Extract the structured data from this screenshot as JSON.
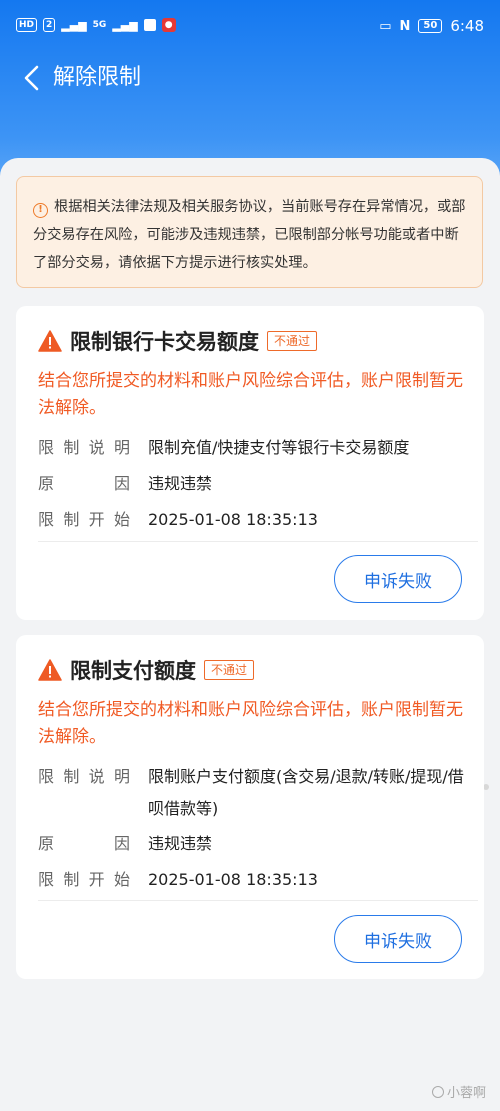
{
  "status_bar": {
    "chips": [
      "HD",
      "2",
      "5G"
    ],
    "time": "6:48",
    "battery": "50"
  },
  "header": {
    "title": "解除限制"
  },
  "notice": {
    "text": "根据相关法律法规及相关服务协议，当前账号存在异常情况，或部分交易存在风险，可能涉及违规违禁，已限制部分帐号功能或者中断了部分交易，请依据下方提示进行核实处理。"
  },
  "cards": [
    {
      "title": "限制银行卡交易额度",
      "badge": "不通过",
      "warning": "结合您所提交的材料和账户风险综合评估，账户限制暂无法解除。",
      "rows": [
        {
          "label": [
            "限",
            "制",
            "说",
            "明"
          ],
          "value": "限制充值/快捷支付等银行卡交易额度"
        },
        {
          "label": [
            "原",
            "因"
          ],
          "value": "违规违禁"
        },
        {
          "label": [
            "限",
            "制",
            "开",
            "始"
          ],
          "value": "2025-01-08 18:35:13"
        }
      ],
      "button": "申诉失败"
    },
    {
      "title": "限制支付额度",
      "badge": "不通过",
      "warning": "结合您所提交的材料和账户风险综合评估，账户限制暂无法解除。",
      "rows": [
        {
          "label": [
            "限",
            "制",
            "说",
            "明"
          ],
          "value": "限制账户支付额度(含交易/退款/转账/提现/借呗借款等)"
        },
        {
          "label": [
            "原",
            "因"
          ],
          "value": "违规违禁"
        },
        {
          "label": [
            "限",
            "制",
            "开",
            "始"
          ],
          "value": "2025-01-08 18:35:13"
        }
      ],
      "button": "申诉失败"
    }
  ],
  "watermark": "小蓉啊",
  "colors": {
    "header_blue": "#1478f0",
    "warning_orange": "#f05a24",
    "button_blue": "#2a7bea",
    "notice_bg": "#fdf0e3"
  },
  "icons": [
    "back-arrow-icon",
    "info-circle-icon",
    "warning-triangle-icon"
  ]
}
